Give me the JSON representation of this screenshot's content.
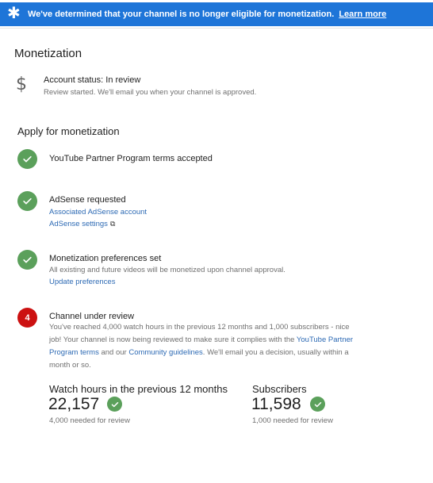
{
  "banner": {
    "message": "We've determined that your channel is no longer eligible for monetization.",
    "link": "Learn more",
    "icon": "star-icon",
    "color": "#1e75d8"
  },
  "section_title": "Monetization",
  "account": {
    "icon": "dollar-icon",
    "status": "Account status: In review",
    "detail": "Review started. We'll email you when your channel is approved."
  },
  "apply_title": "Apply for monetization",
  "steps": [
    {
      "state": "done",
      "title": "YouTube Partner Program terms accepted"
    },
    {
      "state": "done",
      "title": "AdSense requested",
      "links": [
        "Associated AdSense account",
        "AdSense settings"
      ]
    },
    {
      "state": "done",
      "title": "Monetization preferences set",
      "detail": "All existing and future videos will be monetized upon channel approval.",
      "link": "Update preferences"
    },
    {
      "state": "in-progress",
      "number": "4",
      "title": "Channel under review",
      "detail_parts": [
        "You've reached 4,000 watch hours in the previous 12 months and 1,000 subscribers - nice job! Your channel is now being reviewed to make sure it complies with the ",
        "YouTube Partner Program terms",
        " and our ",
        "Community guidelines",
        ". We'll email you a decision, usually within a month or so."
      ]
    }
  ],
  "stats": {
    "watch_hours": {
      "label": "Watch hours in the previous 12 months",
      "value": "22,157",
      "note": "4,000 needed for review"
    },
    "subscribers": {
      "label": "Subscribers",
      "value": "11,598",
      "note": "1,000 needed for review"
    }
  },
  "colors": {
    "check": "#5ba05b",
    "alert": "#cc1111",
    "link": "#2d6ab4"
  }
}
